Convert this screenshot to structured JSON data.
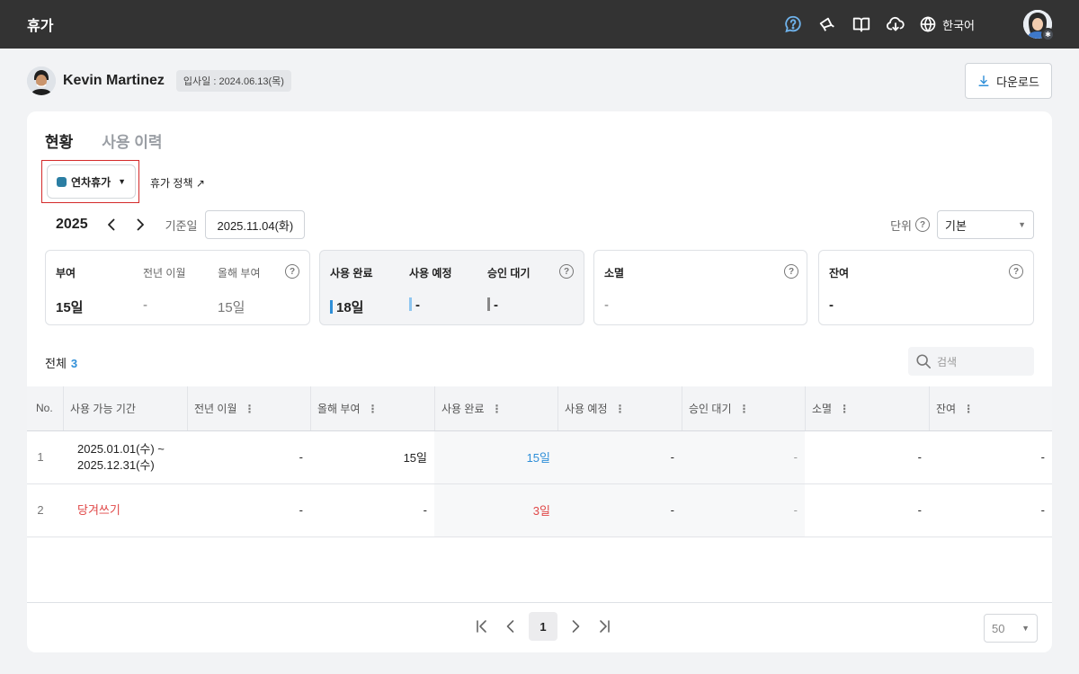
{
  "app": {
    "title": "휴가",
    "language": "한국어"
  },
  "colors": {
    "topbar": "#333333",
    "accent": "#2f8fd8",
    "danger": "#e04848",
    "leave_type": "#2b7ea3"
  },
  "topbar_icons": [
    "help-icon",
    "megaphone-icon",
    "book-icon",
    "cloud-download-icon",
    "globe-icon"
  ],
  "employee": {
    "name": "Kevin Martinez",
    "join_date": "입사일 : 2024.06.13(목)"
  },
  "toolbar": {
    "download_label": "다운로드"
  },
  "tabs": [
    {
      "label": "현황"
    },
    {
      "label": "사용 이력"
    }
  ],
  "leave_type": {
    "label": "연차휴가",
    "policy_link": "휴가 정책 ↗"
  },
  "period": {
    "year": "2025",
    "base_label": "기준일",
    "base_date": "2025.11.04(화)",
    "unit_label": "단위",
    "unit_value": "기본"
  },
  "summary": {
    "grant": {
      "title": "부여",
      "title_value": "15일",
      "carryover_label": "전년 이월",
      "carryover_value": "-",
      "current_label": "올해 부여",
      "current_value": "15일"
    },
    "usage": {
      "used_label": "사용 완료",
      "used_value": "18일",
      "planned_label": "사용 예정",
      "planned_value": "-",
      "pending_label": "승인 대기",
      "pending_value": "-"
    },
    "expired": {
      "label": "소멸",
      "value": "-"
    },
    "remaining": {
      "label": "잔여",
      "value": "-"
    }
  },
  "list": {
    "total_label": "전체",
    "total_count": "3",
    "search_placeholder": "검색"
  },
  "table": {
    "columns": [
      "No.",
      "사용 가능 기간",
      "전년 이월",
      "올해 부여",
      "사용 완료",
      "사용 예정",
      "승인 대기",
      "소멸",
      "잔여"
    ],
    "rows": [
      {
        "no": "1",
        "period_line1": "2025.01.01(수) ~",
        "period_line2": "2025.12.31(수)",
        "carryover": "-",
        "granted": "15일",
        "used": "15일",
        "planned": "-",
        "pending": "-",
        "expired": "-",
        "remaining": "-"
      },
      {
        "no": "2",
        "period_line1": "당겨쓰기",
        "carryover": "-",
        "granted": "-",
        "used": "3일",
        "planned": "-",
        "pending": "-",
        "expired": "-",
        "remaining": "-"
      }
    ]
  },
  "pagination": {
    "current_page": "1",
    "page_size": "50"
  }
}
